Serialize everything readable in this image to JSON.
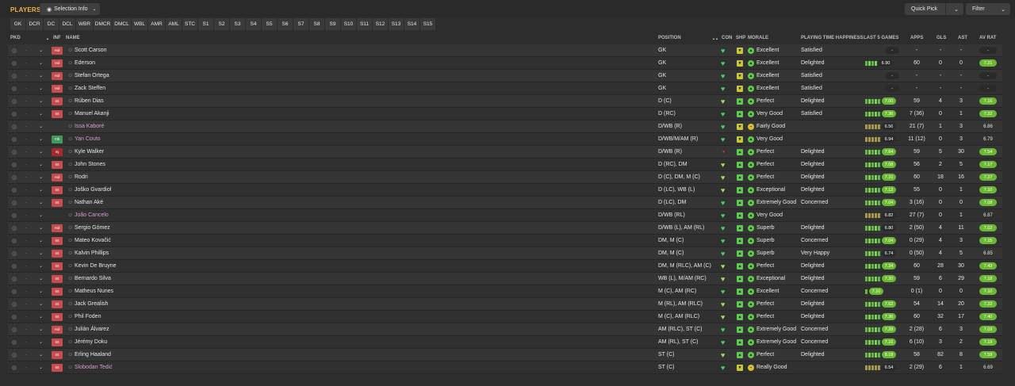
{
  "header": {
    "title": "PLAYERS",
    "selection_info": "Selection Info",
    "quick_pick": "Quick Pick",
    "filter": "Filter"
  },
  "positions": [
    "GK",
    "DCR",
    "DC",
    "DCL",
    "WBR",
    "DMCR",
    "DMCL",
    "WBL",
    "AMR",
    "AML",
    "STC",
    "S1",
    "S2",
    "S3",
    "S4",
    "S5",
    "S6",
    "S7",
    "S8",
    "S9",
    "S10",
    "S11",
    "S12",
    "S13",
    "S14",
    "S15"
  ],
  "columns": {
    "pkd": "PKD",
    "inf": "INF",
    "name": "NAME",
    "position": "POSITION",
    "sort": "▲▲",
    "con": "CON",
    "shp": "SHP",
    "morale": "MORALE",
    "pth": "PLAYING TIME HAPPINESS",
    "last5": "LAST 5 GAMES",
    "apps": "APPS",
    "gls": "GLS",
    "ast": "AST",
    "avrat": "AV RAT"
  },
  "colors": {
    "accent": "#f0b43c",
    "badge_red": "#c94c4c",
    "badge_green": "#3f9a5c",
    "green_rating": "#6bb832",
    "heart_green": "#46d26a",
    "loan_name": "#d79bd8"
  },
  "players": [
    {
      "name": "Scott Carson",
      "loan": false,
      "inf": "Hol",
      "inf_type": "red",
      "pos": "GK",
      "con_color": "#46d26a",
      "shp": "down",
      "morale": "Excellent",
      "morale_type": "good",
      "pth": "Satisfied",
      "last5": [],
      "last5_rating": "-",
      "apps": "-",
      "gls": "-",
      "ast": "-",
      "avrat": "-",
      "avrat_style": "dark"
    },
    {
      "name": "Ederson",
      "loan": false,
      "inf": "Hol",
      "inf_type": "red",
      "pos": "GK",
      "con_color": "#46d26a",
      "shp": "down",
      "morale": "Excellent",
      "morale_type": "good",
      "pth": "Delighted",
      "last5": [
        1,
        1,
        1,
        1
      ],
      "last5_rating": "6.90",
      "last5_style": "dark",
      "apps": "60",
      "gls": "0",
      "ast": "0",
      "avrat": "7.21",
      "avrat_style": "green"
    },
    {
      "name": "Stefan Ortega",
      "loan": false,
      "inf": "Hol",
      "inf_type": "red",
      "pos": "GK",
      "con_color": "#46d26a",
      "shp": "down",
      "morale": "Excellent",
      "morale_type": "good",
      "pth": "Satisfied",
      "last5": [],
      "last5_rating": "-",
      "apps": "-",
      "gls": "-",
      "ast": "-",
      "avrat": "-",
      "avrat_style": "dark"
    },
    {
      "name": "Zack Steffen",
      "loan": false,
      "inf": "Hol",
      "inf_type": "red",
      "pos": "GK",
      "con_color": "#46d26a",
      "shp": "down",
      "morale": "Excellent",
      "morale_type": "good",
      "pth": "Satisfied",
      "last5": [],
      "last5_rating": "-",
      "apps": "-",
      "gls": "-",
      "ast": "-",
      "avrat": "-",
      "avrat_style": "dark"
    },
    {
      "name": "Rúben Dias",
      "loan": false,
      "inf": "Int",
      "inf_type": "red",
      "pos": "D (C)",
      "con_color": "#9ee05a",
      "shp": "up",
      "morale": "Perfect",
      "morale_type": "good",
      "pth": "Delighted",
      "last5": [
        1,
        1,
        1,
        1,
        1
      ],
      "last5_rating": "7.00",
      "last5_style": "green",
      "apps": "59",
      "gls": "4",
      "ast": "3",
      "avrat": "7.16",
      "avrat_style": "green"
    },
    {
      "name": "Manuel Akanji",
      "loan": false,
      "inf": "Int",
      "inf_type": "red",
      "pos": "D (RC)",
      "con_color": "#46d26a",
      "shp": "up",
      "morale": "Very Good",
      "morale_type": "good",
      "pth": "Satisfied",
      "last5": [
        1,
        1,
        1,
        1,
        1
      ],
      "last5_rating": "7.36",
      "last5_style": "green",
      "apps": "7 (36)",
      "gls": "0",
      "ast": "1",
      "avrat": "7.22",
      "avrat_style": "green"
    },
    {
      "name": "Issa Kaboré",
      "loan": true,
      "inf": "",
      "inf_type": "none",
      "pos": "D/WB (R)",
      "con_color": "#46d26a",
      "shp": "down",
      "morale": "Fairly Good",
      "morale_type": "ok",
      "pth": "",
      "last5": [
        0,
        0,
        0,
        0,
        0
      ],
      "last5_rating": "6.56",
      "last5_style": "dark",
      "apps": "21 (7)",
      "gls": "1",
      "ast": "3",
      "avrat": "6.86",
      "avrat_style": "plain"
    },
    {
      "name": "Yan Couto",
      "loan": true,
      "inf": "Yth",
      "inf_type": "green",
      "pos": "D/WB/M/AM (R)",
      "con_color": "#46d26a",
      "shp": "down",
      "morale": "Very Good",
      "morale_type": "good",
      "pth": "",
      "last5": [
        0,
        0,
        0,
        0,
        0
      ],
      "last5_rating": "6.94",
      "last5_style": "dark",
      "apps": "11 (12)",
      "gls": "0",
      "ast": "3",
      "avrat": "6.79",
      "avrat_style": "plain"
    },
    {
      "name": "Kyle Walker",
      "loan": false,
      "inf": "Inj",
      "inf_type": "dred",
      "pos": "D/WB (R)",
      "con_color": "#d23030",
      "con_dot": true,
      "shp": "up",
      "morale": "Perfect",
      "morale_type": "good",
      "pth": "Delighted",
      "last5": [
        1,
        1,
        1,
        1,
        1
      ],
      "last5_rating": "7.64",
      "last5_style": "green",
      "apps": "59",
      "gls": "5",
      "ast": "30",
      "avrat": "7.54",
      "avrat_style": "green"
    },
    {
      "name": "John Stones",
      "loan": false,
      "inf": "Int",
      "inf_type": "red",
      "pos": "D (RC), DM",
      "con_color": "#9ee05a",
      "shp": "up",
      "morale": "Perfect",
      "morale_type": "good",
      "pth": "Delighted",
      "last5": [
        1,
        1,
        1,
        1,
        1
      ],
      "last5_rating": "7.08",
      "last5_style": "green",
      "apps": "56",
      "gls": "2",
      "ast": "5",
      "avrat": "7.17",
      "avrat_style": "green"
    },
    {
      "name": "Rodri",
      "loan": false,
      "inf": "Hol",
      "inf_type": "red",
      "pos": "D (C), DM, M (C)",
      "con_color": "#9ee05a",
      "shp": "up",
      "morale": "Perfect",
      "morale_type": "good",
      "pth": "Delighted",
      "last5": [
        1,
        1,
        1,
        1,
        1
      ],
      "last5_rating": "7.10",
      "last5_style": "green",
      "apps": "60",
      "gls": "18",
      "ast": "16",
      "avrat": "7.27",
      "avrat_style": "green"
    },
    {
      "name": "Joško Gvardiol",
      "loan": false,
      "inf": "Int",
      "inf_type": "red",
      "pos": "D (LC), WB (L)",
      "con_color": "#9ee05a",
      "shp": "up",
      "morale": "Exceptional",
      "morale_type": "good",
      "pth": "Delighted",
      "last5": [
        1,
        1,
        1,
        1,
        1
      ],
      "last5_rating": "7.12",
      "last5_style": "green",
      "apps": "55",
      "gls": "0",
      "ast": "1",
      "avrat": "7.10",
      "avrat_style": "green"
    },
    {
      "name": "Nathan Aké",
      "loan": false,
      "inf": "Int",
      "inf_type": "red",
      "pos": "D (LC), DM",
      "con_color": "#46d26a",
      "shp": "up",
      "morale": "Extremely Good",
      "morale_type": "good",
      "pth": "Concerned",
      "last5": [
        1,
        1,
        1,
        1,
        1
      ],
      "last5_rating": "7.04",
      "last5_style": "green",
      "apps": "3 (16)",
      "gls": "0",
      "ast": "0",
      "avrat": "7.08",
      "avrat_style": "green"
    },
    {
      "name": "João Cancelo",
      "loan": true,
      "inf": "",
      "inf_type": "none",
      "pos": "D/WB (RL)",
      "con_color": "#46d26a",
      "shp": "up",
      "morale": "Very Good",
      "morale_type": "good",
      "pth": "",
      "last5": [
        0,
        0,
        0,
        0,
        0
      ],
      "last5_rating": "6.82",
      "last5_style": "dark",
      "apps": "27 (7)",
      "gls": "0",
      "ast": "1",
      "avrat": "6.87",
      "avrat_style": "plain"
    },
    {
      "name": "Sergio Gómez",
      "loan": false,
      "inf": "Hol",
      "inf_type": "red",
      "pos": "D/WB (L), AM (RL)",
      "con_color": "#46d26a",
      "shp": "up",
      "morale": "Superb",
      "morale_type": "good",
      "pth": "Delighted",
      "last5": [
        1,
        1,
        1,
        1,
        1
      ],
      "last5_rating": "6.80",
      "last5_style": "dark",
      "apps": "2 (50)",
      "gls": "4",
      "ast": "11",
      "avrat": "7.02",
      "avrat_style": "green"
    },
    {
      "name": "Mateo Kovačić",
      "loan": false,
      "inf": "Int",
      "inf_type": "red",
      "pos": "DM, M (C)",
      "con_color": "#46d26a",
      "shp": "up",
      "morale": "Superb",
      "morale_type": "good",
      "pth": "Concerned",
      "last5": [
        1,
        1,
        1,
        1,
        1
      ],
      "last5_rating": "7.04",
      "last5_style": "green",
      "apps": "0 (29)",
      "gls": "4",
      "ast": "3",
      "avrat": "7.15",
      "avrat_style": "green"
    },
    {
      "name": "Kalvin Phillips",
      "loan": false,
      "inf": "Int",
      "inf_type": "red",
      "pos": "DM, M (C)",
      "con_color": "#46d26a",
      "shp": "up",
      "morale": "Superb",
      "morale_type": "good",
      "pth": "Very Happy",
      "last5": [
        1,
        1,
        1,
        1,
        1
      ],
      "last5_rating": "6.74",
      "last5_style": "dark",
      "apps": "0 (50)",
      "gls": "4",
      "ast": "5",
      "avrat": "6.85",
      "avrat_style": "plain"
    },
    {
      "name": "Kevin De Bruyne",
      "loan": false,
      "inf": "Int",
      "inf_type": "red",
      "pos": "DM, M (RLC), AM (C)",
      "con_color": "#9ee05a",
      "shp": "up",
      "morale": "Perfect",
      "morale_type": "good",
      "pth": "Delighted",
      "last5": [
        1,
        1,
        1,
        1,
        1
      ],
      "last5_rating": "7.34",
      "last5_style": "green",
      "apps": "60",
      "gls": "28",
      "ast": "30",
      "avrat": "7.43",
      "avrat_style": "green"
    },
    {
      "name": "Bernardo Silva",
      "loan": false,
      "inf": "Int",
      "inf_type": "red",
      "pos": "WB (L), M/AM (RC)",
      "con_color": "#9ee05a",
      "shp": "up",
      "morale": "Exceptional",
      "morale_type": "good",
      "pth": "Delighted",
      "last5": [
        1,
        1,
        1,
        1,
        1
      ],
      "last5_rating": "7.20",
      "last5_style": "green",
      "apps": "59",
      "gls": "6",
      "ast": "29",
      "avrat": "7.18",
      "avrat_style": "green"
    },
    {
      "name": "Matheus Nunes",
      "loan": false,
      "inf": "Int",
      "inf_type": "red",
      "pos": "M (C), AM (RC)",
      "con_color": "#46d26a",
      "shp": "up",
      "morale": "Excellent",
      "morale_type": "good",
      "pth": "Concerned",
      "last5": [
        1
      ],
      "last5_rating": "7.10",
      "last5_style": "green",
      "apps": "0 (1)",
      "gls": "0",
      "ast": "0",
      "avrat": "7.10",
      "avrat_style": "green"
    },
    {
      "name": "Jack Grealish",
      "loan": false,
      "inf": "Int",
      "inf_type": "red",
      "pos": "M (RL), AM (RLC)",
      "con_color": "#9ee05a",
      "shp": "up",
      "morale": "Perfect",
      "morale_type": "good",
      "pth": "Delighted",
      "last5": [
        1,
        1,
        1,
        1,
        1
      ],
      "last5_rating": "7.62",
      "last5_style": "green",
      "apps": "54",
      "gls": "14",
      "ast": "20",
      "avrat": "7.22",
      "avrat_style": "green"
    },
    {
      "name": "Phil Foden",
      "loan": false,
      "inf": "Int",
      "inf_type": "red",
      "pos": "M (C), AM (RLC)",
      "con_color": "#9ee05a",
      "shp": "up",
      "morale": "Perfect",
      "morale_type": "good",
      "pth": "Delighted",
      "last5": [
        1,
        1,
        1,
        1,
        1
      ],
      "last5_rating": "7.36",
      "last5_style": "green",
      "apps": "60",
      "gls": "32",
      "ast": "17",
      "avrat": "7.40",
      "avrat_style": "green"
    },
    {
      "name": "Julián Álvarez",
      "loan": false,
      "inf": "Hol",
      "inf_type": "red",
      "pos": "AM (RLC), ST (C)",
      "con_color": "#46d26a",
      "shp": "up",
      "morale": "Extremely Good",
      "morale_type": "good",
      "pth": "Concerned",
      "last5": [
        1,
        1,
        1,
        1,
        1
      ],
      "last5_rating": "7.28",
      "last5_style": "green",
      "apps": "2 (28)",
      "gls": "6",
      "ast": "3",
      "avrat": "7.09",
      "avrat_style": "green"
    },
    {
      "name": "Jérémy Doku",
      "loan": false,
      "inf": "Int",
      "inf_type": "red",
      "pos": "AM (RL), ST (C)",
      "con_color": "#46d26a",
      "shp": "up",
      "morale": "Extremely Good",
      "morale_type": "good",
      "pth": "Concerned",
      "last5": [
        1,
        1,
        1,
        1,
        1
      ],
      "last5_rating": "7.16",
      "last5_style": "green",
      "apps": "6 (10)",
      "gls": "3",
      "ast": "2",
      "avrat": "7.19",
      "avrat_style": "green"
    },
    {
      "name": "Erling Haaland",
      "loan": false,
      "inf": "Int",
      "inf_type": "red",
      "pos": "ST (C)",
      "con_color": "#9ee05a",
      "shp": "up",
      "morale": "Perfect",
      "morale_type": "good",
      "pth": "Delighted",
      "last5": [
        1,
        1,
        1,
        1,
        1
      ],
      "last5_rating": "8.18",
      "last5_style": "green",
      "apps": "58",
      "gls": "82",
      "ast": "8",
      "avrat": "7.59",
      "avrat_style": "green"
    },
    {
      "name": "Slobodan Tedić",
      "loan": true,
      "inf": "Int",
      "inf_type": "red",
      "pos": "ST (C)",
      "con_color": "#46d26a",
      "shp": "down",
      "morale": "Really Good",
      "morale_type": "ok",
      "pth": "",
      "last5": [
        0,
        0,
        0,
        0,
        0
      ],
      "last5_rating": "6.54",
      "last5_style": "dark",
      "apps": "2 (29)",
      "gls": "6",
      "ast": "1",
      "avrat": "6.69",
      "avrat_style": "plain"
    }
  ]
}
